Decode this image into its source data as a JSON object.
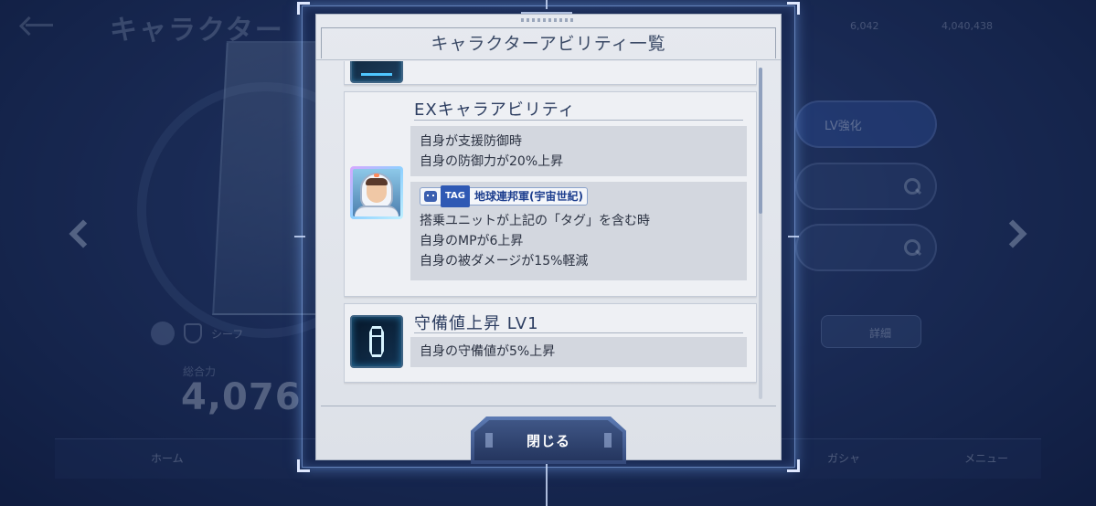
{
  "background": {
    "screen_title": "キャラクター",
    "cost_label": "総合力",
    "cost_value": "4,076",
    "currency_a": "6,042",
    "currency_b": "4,040,438",
    "lv_up_button": "LV強化",
    "detail_button": "詳細",
    "nav_home": "ホーム",
    "nav_gacha": "ガシャ",
    "nav_menu": "メニュー",
    "pilot_name_partial": "シーフ"
  },
  "dialog": {
    "title": "キャラクターアビリティ一覧",
    "close_label": "閉じる"
  },
  "abilities": [
    {
      "name": "EXキャラアビリティ",
      "condition_lines": [
        "自身が支援防御時",
        "自身の防御力が20%上昇"
      ],
      "tag": {
        "label": "TAG",
        "name": "地球連邦軍(宇宙世紀)"
      },
      "tag_effect_lines": [
        "搭乗ユニットが上記の「タグ」を含む時",
        "自身のMPが6上昇",
        "自身の被ダメージが15%軽減"
      ],
      "icon": "character-portrait-icon"
    },
    {
      "name": "守備値上昇 LV1",
      "condition_lines": [
        "自身の守備値が5%上昇"
      ],
      "icon": "defense-coffin-icon"
    }
  ]
}
